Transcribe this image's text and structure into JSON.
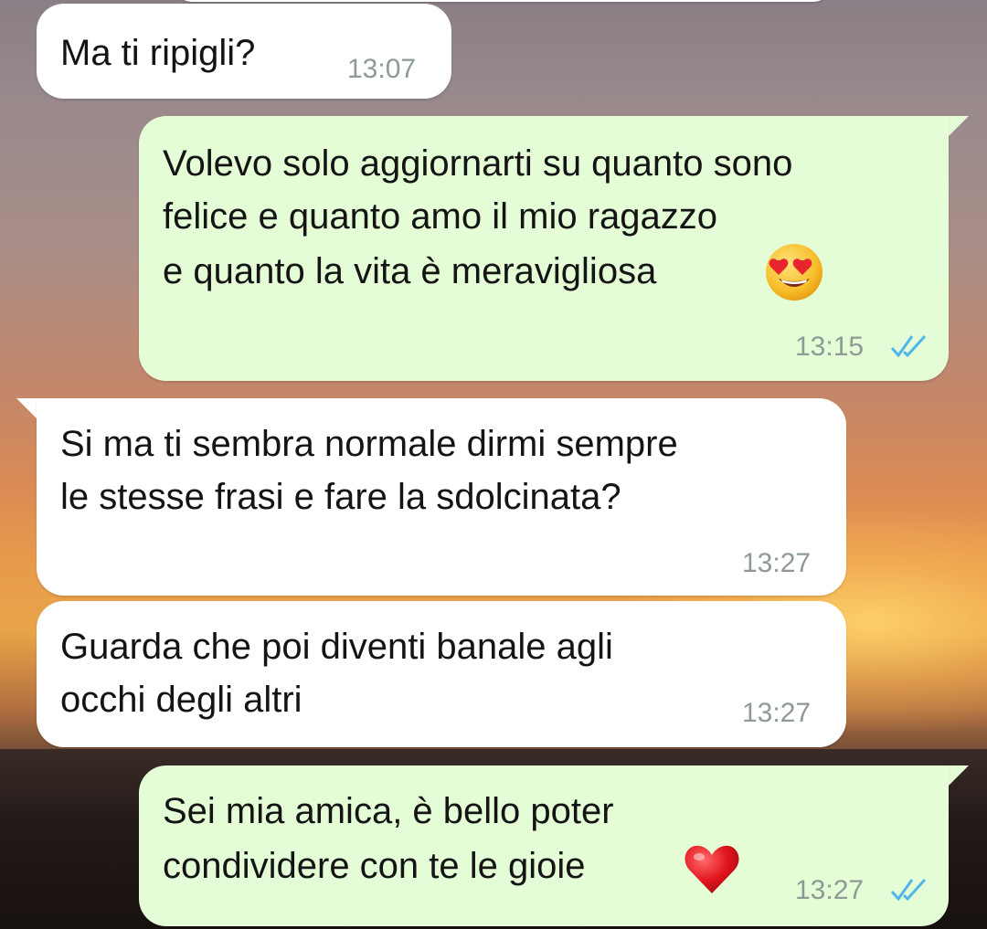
{
  "messages": [
    {
      "direction": "incoming",
      "text": "Ma ti ripigli?",
      "time": "13:07"
    },
    {
      "direction": "outgoing",
      "text_lines": [
        "Volevo solo aggiornarti su quanto sono",
        "felice e quanto amo il mio ragazzo",
        "e quanto la vita è meravigliosa"
      ],
      "emoji": "heart-eyes-emoji",
      "time": "13:15",
      "status": "read"
    },
    {
      "direction": "incoming",
      "text_lines": [
        "Si ma ti sembra normale dirmi sempre",
        "le stesse frasi e fare la sdolcinata?"
      ],
      "time": "13:27"
    },
    {
      "direction": "incoming",
      "text_lines": [
        "Guarda che poi diventi banale agli",
        "occhi degli altri"
      ],
      "time": "13:27"
    },
    {
      "direction": "outgoing",
      "text_lines": [
        "Sei mia amica, è bello poter",
        "condividere con te le gioie"
      ],
      "emoji": "red-heart-emoji",
      "time": "13:27",
      "status": "read"
    }
  ],
  "colors": {
    "incoming_bubble": "#ffffff",
    "outgoing_bubble": "#e5fdd7",
    "read_ticks": "#4fb6ec",
    "timestamp": "#8e9a93"
  }
}
